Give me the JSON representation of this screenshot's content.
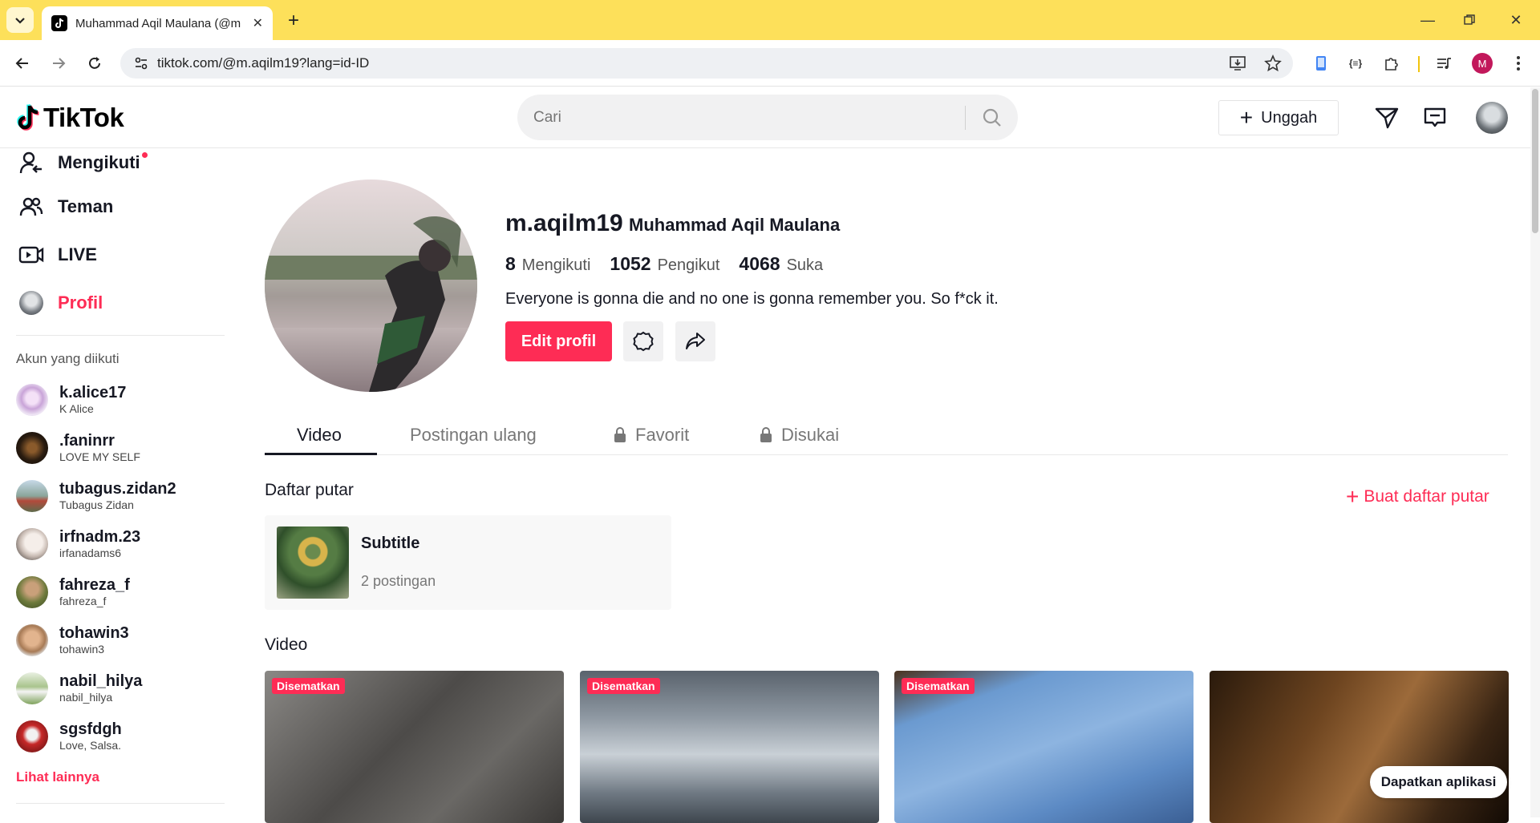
{
  "browser": {
    "tab_title": "Muhammad Aqil Maulana (@m",
    "url": "tiktok.com/@m.aqilm19?lang=id-ID",
    "profile_initial": "M"
  },
  "header": {
    "logo_text": "TikTok",
    "search_placeholder": "Cari",
    "upload_label": "Unggah"
  },
  "sidebar": {
    "nav": [
      {
        "label": "Mengikuti",
        "icon": "following-icon"
      },
      {
        "label": "Teman",
        "icon": "friends-icon"
      },
      {
        "label": "LIVE",
        "icon": "live-icon"
      },
      {
        "label": "Profil",
        "icon": "profile-avatar-icon"
      }
    ],
    "following_caption": "Akun yang diikuti",
    "following": [
      {
        "name": "k.alice17",
        "sub": "K Alice"
      },
      {
        "name": ".faninrr",
        "sub": "LOVE MY SELF"
      },
      {
        "name": "tubagus.zidan2",
        "sub": "Tubagus Zidan"
      },
      {
        "name": "irfnadm.23",
        "sub": "irfanadams6"
      },
      {
        "name": "fahreza_f",
        "sub": "fahreza_f"
      },
      {
        "name": "tohawin3",
        "sub": "tohawin3"
      },
      {
        "name": "nabil_hilya",
        "sub": "nabil_hilya"
      },
      {
        "name": "sgsfdgh",
        "sub": "Love, Salsa."
      }
    ],
    "see_more": "Lihat lainnya"
  },
  "profile": {
    "username": "m.aqilm19",
    "fullname": "Muhammad Aqil Maulana",
    "stats": [
      {
        "value": "8",
        "label": "Mengikuti"
      },
      {
        "value": "1052",
        "label": "Pengikut"
      },
      {
        "value": "4068",
        "label": "Suka"
      }
    ],
    "bio": "Everyone is gonna die and no one is gonna remember you. So f*ck it.",
    "edit_label": "Edit profil"
  },
  "tabs": [
    {
      "label": "Video",
      "locked": false
    },
    {
      "label": "Postingan ulang",
      "locked": false
    },
    {
      "label": "Favorit",
      "locked": true
    },
    {
      "label": "Disukai",
      "locked": true
    }
  ],
  "playlists": {
    "heading": "Daftar putar",
    "create_label": "Buat daftar putar",
    "items": [
      {
        "title": "Subtitle",
        "count": "2 postingan"
      }
    ]
  },
  "videos": {
    "heading": "Video",
    "badge": "Disematkan",
    "get_app": "Dapatkan aplikasi"
  }
}
